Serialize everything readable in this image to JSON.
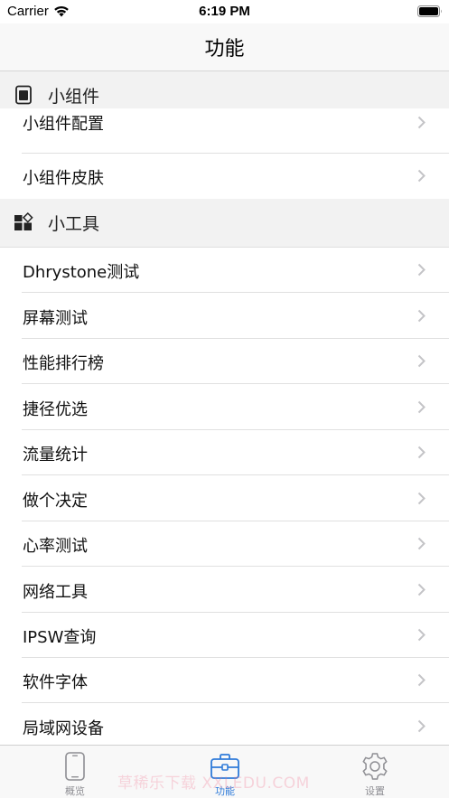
{
  "status_bar": {
    "carrier": "Carrier",
    "time": "6:19 PM"
  },
  "nav": {
    "title": "功能"
  },
  "sections": [
    {
      "title": "小组件",
      "icon": "widget-icon",
      "items": [
        "小组件配置",
        "小组件皮肤"
      ]
    },
    {
      "title": "小工具",
      "icon": "tools-icon",
      "items": [
        "Dhrystone测试",
        "屏幕测试",
        "性能排行榜",
        "捷径优选",
        "流量统计",
        "做个决定",
        "心率测试",
        "网络工具",
        "IPSW查询",
        "软件字体",
        "局域网设备"
      ]
    }
  ],
  "tabs": [
    {
      "label": "概览",
      "icon": "phone-icon",
      "active": false
    },
    {
      "label": "功能",
      "icon": "toolbox-icon",
      "active": true
    },
    {
      "label": "设置",
      "icon": "gear-icon",
      "active": false
    }
  ],
  "watermark": "草稀乐下载 XXLEDU.COM",
  "colors": {
    "accent": "#2f7bd9",
    "inactive_tab": "#8e8e93",
    "section_bg": "#f2f2f2",
    "chevron": "#c4c4c7"
  }
}
